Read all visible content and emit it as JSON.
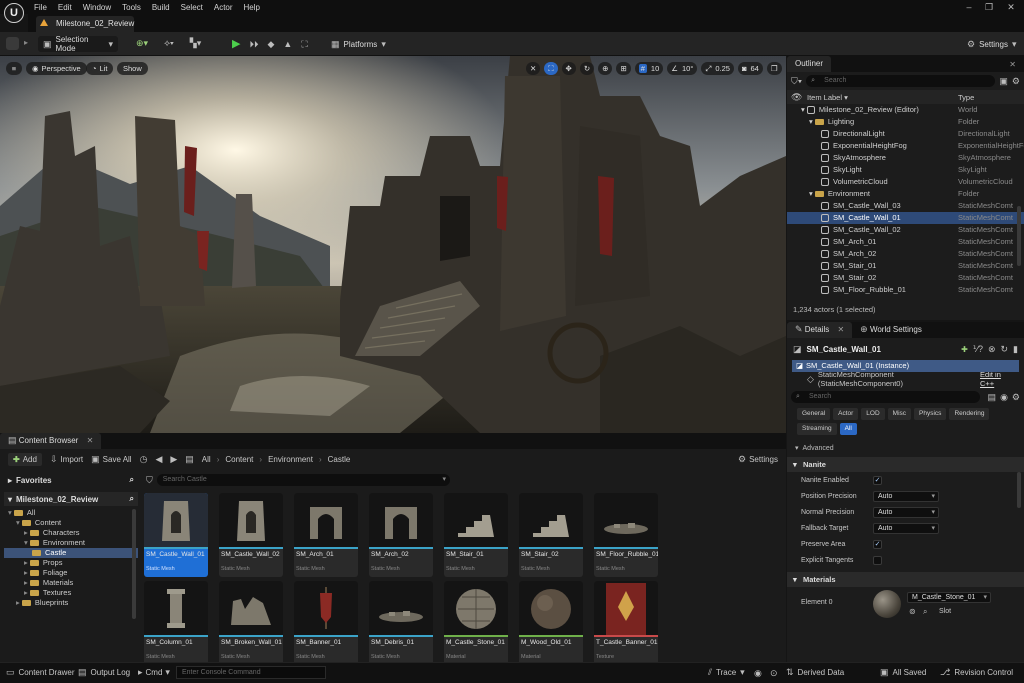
{
  "menubar": {
    "items": [
      "File",
      "Edit",
      "Window",
      "Tools",
      "Build",
      "Select",
      "Actor",
      "Help"
    ]
  },
  "document_tab": {
    "title": "Milestone_02_Review"
  },
  "toolbar": {
    "mode_label": "Selection Mode",
    "platforms_label": "Platforms",
    "settings_label": "Settings"
  },
  "viewport": {
    "perspective_label": "Perspective",
    "lit_label": "Lit",
    "show_label": "Show",
    "grid_snap_value": "10",
    "rotation_snap_value": "10°",
    "scale_snap_value": "0.25",
    "camera_speed_value": "64"
  },
  "outliner": {
    "tab_label": "Outliner",
    "search_placeholder": "Search",
    "col_label": "Item Label",
    "col_type": "Type",
    "rows": [
      {
        "name": "Milestone_02_Review (Editor)",
        "type": "World"
      },
      {
        "name": "Lighting",
        "type": "Folder"
      },
      {
        "name": "DirectionalLight",
        "type": "DirectionalLight"
      },
      {
        "name": "ExponentialHeightFog",
        "type": "ExponentialHeightFo"
      },
      {
        "name": "SkyAtmosphere",
        "type": "SkyAtmosphere"
      },
      {
        "name": "SkyLight",
        "type": "SkyLight"
      },
      {
        "name": "VolumetricCloud",
        "type": "VolumetricCloud"
      },
      {
        "name": "Environment",
        "type": "Folder"
      },
      {
        "name": "SM_Castle_Wall_03",
        "type": "StaticMeshComt"
      },
      {
        "name": "SM_Castle_Wall_01",
        "type": "StaticMeshComt"
      },
      {
        "name": "SM_Castle_Wall_02",
        "type": "StaticMeshComt"
      },
      {
        "name": "SM_Arch_01",
        "type": "StaticMeshComt"
      },
      {
        "name": "SM_Arch_02",
        "type": "StaticMeshComt"
      },
      {
        "name": "SM_Stair_01",
        "type": "StaticMeshComt"
      },
      {
        "name": "SM_Stair_02",
        "type": "StaticMeshComt"
      },
      {
        "name": "SM_Floor_Rubble_01",
        "type": "StaticMeshComt"
      }
    ],
    "footer": "1,234 actors (1 selected)"
  },
  "details": {
    "tab_details": "Details",
    "tab_world_settings": "World Settings",
    "actor_name": "SM_Castle_Wall_01",
    "instance_label": "SM_Castle_Wall_01 (Instance)",
    "component_label": "StaticMeshComponent (StaticMeshComponent0)",
    "edit_cpp": "Edit in C++",
    "search_placeholder": "Search",
    "categories": [
      "General",
      "Actor",
      "LOD",
      "Misc",
      "Physics",
      "Rendering",
      "Streaming",
      "All"
    ],
    "advanced_label": "Advanced",
    "nanite_header": "Nanite",
    "props": {
      "nanite_enabled": "Nanite Enabled",
      "position_precision": "Position Precision",
      "position_precision_value": "Auto",
      "normal_precision": "Normal Precision",
      "normal_precision_value": "Auto",
      "fallback_target": "Fallback Target",
      "fallback_target_value": "Auto",
      "preserve_area": "Preserve Area",
      "explicit_tangents": "Explicit Tangents"
    },
    "materials_header": "Materials",
    "element0_label": "Element 0",
    "element0_material": "M_Castle_Stone_01",
    "slot_label": "Slot"
  },
  "content_browser": {
    "tab_label": "Content Browser",
    "add_label": "Add",
    "import_label": "Import",
    "save_all_label": "Save All",
    "breadcrumb": [
      "All",
      "Content",
      "Environment",
      "Castle"
    ],
    "settings_label": "Settings",
    "favorites_label": "Favorites",
    "project_label": "Milestone_02_Review",
    "search_placeholder": "Search Castle",
    "tree": [
      {
        "label": "All",
        "depth": 0
      },
      {
        "label": "Content",
        "depth": 1
      },
      {
        "label": "Characters",
        "depth": 2
      },
      {
        "label": "Environment",
        "depth": 2
      },
      {
        "label": "Castle",
        "depth": 3
      },
      {
        "label": "Props",
        "depth": 2
      },
      {
        "label": "Foliage",
        "depth": 2
      },
      {
        "label": "Materials",
        "depth": 2
      },
      {
        "label": "Textures",
        "depth": 2
      },
      {
        "label": "Blueprints",
        "depth": 1
      }
    ],
    "assets": [
      {
        "name": "SM_Castle_Wall_01",
        "type": "Static Mesh",
        "strip": "#3ba3c8",
        "shape": "wall"
      },
      {
        "name": "SM_Castle_Wall_02",
        "type": "Static Mesh",
        "strip": "#3ba3c8",
        "shape": "wall"
      },
      {
        "name": "SM_Arch_01",
        "type": "Static Mesh",
        "strip": "#3ba3c8",
        "shape": "arch"
      },
      {
        "name": "SM_Arch_02",
        "type": "Static Mesh",
        "strip": "#3ba3c8",
        "shape": "arch"
      },
      {
        "name": "SM_Stair_01",
        "type": "Static Mesh",
        "strip": "#3ba3c8",
        "shape": "stair"
      },
      {
        "name": "SM_Stair_02",
        "type": "Static Mesh",
        "strip": "#3ba3c8",
        "shape": "stair"
      },
      {
        "name": "SM_Floor_Rubble_01",
        "type": "Static Mesh",
        "strip": "#3ba3c8",
        "shape": "rubble"
      },
      {
        "name": "SM_Column_01",
        "type": "Static Mesh",
        "strip": "#3ba3c8",
        "shape": "column"
      },
      {
        "name": "SM_Broken_Wall_01",
        "type": "Static Mesh",
        "strip": "#3ba3c8",
        "shape": "broken"
      },
      {
        "name": "SM_Banner_01",
        "type": "Static Mesh",
        "strip": "#3ba3c8",
        "shape": "banner"
      },
      {
        "name": "SM_Debris_01",
        "type": "Static Mesh",
        "strip": "#3ba3c8",
        "shape": "rubble"
      },
      {
        "name": "M_Castle_Stone_01",
        "type": "Material",
        "strip": "#6fb04a",
        "shape": "sphere"
      },
      {
        "name": "M_Wood_Old_01",
        "type": "Material",
        "strip": "#6fb04a",
        "shape": "sphere2"
      },
      {
        "name": "T_Castle_Banner_01",
        "type": "Texture",
        "strip": "#c84a4a",
        "shape": "texbanner"
      }
    ]
  },
  "statusbar": {
    "content_drawer": "Content Drawer",
    "output_log": "Output Log",
    "cmd_label": "Cmd",
    "console_placeholder": "Enter Console Command",
    "trace_label": "Trace",
    "derived_data": "Derived Data",
    "all_saved": "All Saved",
    "revision_control": "Revision Control"
  }
}
